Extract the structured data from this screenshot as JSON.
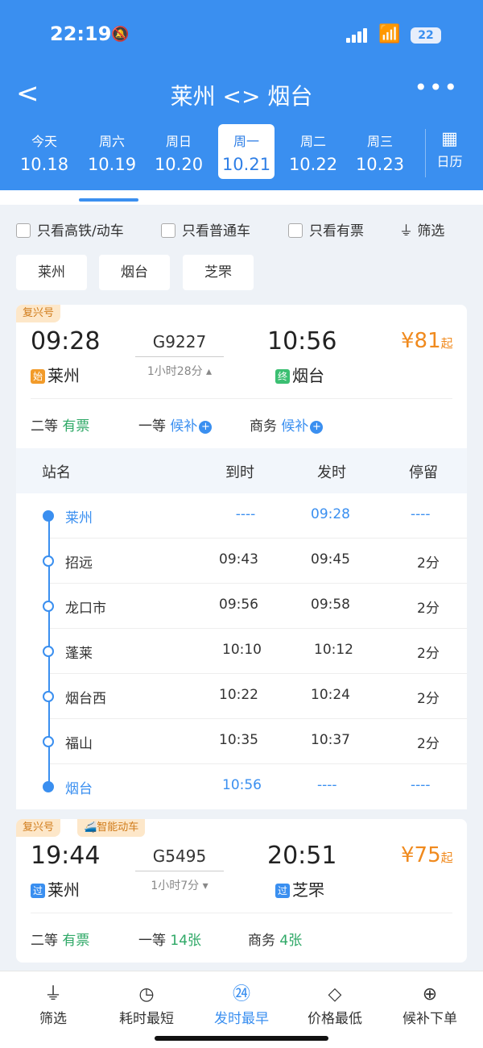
{
  "status": {
    "time": "22:19",
    "battery": "22"
  },
  "nav": {
    "back": "<",
    "title": "莱州 <> 烟台",
    "more": "•••"
  },
  "dates": [
    {
      "wd": "今天",
      "dd": "10.18"
    },
    {
      "wd": "周六",
      "dd": "10.19"
    },
    {
      "wd": "周日",
      "dd": "10.20"
    },
    {
      "wd": "周一",
      "dd": "10.21",
      "active": true
    },
    {
      "wd": "周二",
      "dd": "10.22"
    },
    {
      "wd": "周三",
      "dd": "10.23"
    }
  ],
  "calendar_label": "日历",
  "filters": {
    "highspeed": "只看高铁/动车",
    "normal": "只看普通车",
    "available": "只看有票",
    "filter_btn": "筛选"
  },
  "stations": [
    "莱州",
    "烟台",
    "芝罘"
  ],
  "train1": {
    "tag": "复兴号",
    "dep_time": "09:28",
    "dep_badge": "始",
    "dep_station": "莱州",
    "train_no": "G9227",
    "duration": "1小时28分 ▴",
    "arr_time": "10:56",
    "arr_badge": "终",
    "arr_station": "烟台",
    "price": "¥81",
    "price_suffix": "起",
    "seats": [
      {
        "cls": "二等",
        "status": "有票"
      },
      {
        "cls": "一等",
        "status": "候补"
      },
      {
        "cls": "商务",
        "status": "候补"
      }
    ],
    "stop_header": {
      "name": "站名",
      "arrive": "到时",
      "depart": "发时",
      "stay": "停留"
    },
    "stops": [
      {
        "name": "莱州",
        "arrive": "----",
        "depart": "09:28",
        "stay": "----"
      },
      {
        "name": "招远",
        "arrive": "09:43",
        "depart": "09:45",
        "stay": "2分"
      },
      {
        "name": "龙口市",
        "arrive": "09:56",
        "depart": "09:58",
        "stay": "2分"
      },
      {
        "name": "蓬莱",
        "arrive": "10:10",
        "depart": "10:12",
        "stay": "2分"
      },
      {
        "name": "烟台西",
        "arrive": "10:22",
        "depart": "10:24",
        "stay": "2分"
      },
      {
        "name": "福山",
        "arrive": "10:35",
        "depart": "10:37",
        "stay": "2分"
      },
      {
        "name": "烟台",
        "arrive": "10:56",
        "depart": "----",
        "stay": "----"
      }
    ]
  },
  "train2": {
    "tag": "复兴号",
    "tag2": "智能动车",
    "dep_time": "19:44",
    "dep_badge": "过",
    "dep_station": "莱州",
    "train_no": "G5495",
    "duration": "1小时7分 ▾",
    "arr_time": "20:51",
    "arr_badge": "过",
    "arr_station": "芝罘",
    "price": "¥75",
    "price_suffix": "起",
    "seats": [
      {
        "cls": "二等",
        "status": "有票"
      },
      {
        "cls": "一等",
        "status": "14张"
      },
      {
        "cls": "商务",
        "status": "4张"
      }
    ]
  },
  "bottom_tabs": [
    {
      "icon": "⏚",
      "label": "筛选"
    },
    {
      "icon": "◷",
      "label": "耗时最短"
    },
    {
      "icon": "㉔",
      "label": "发时最早",
      "active": true
    },
    {
      "icon": "◇",
      "label": "价格最低"
    },
    {
      "icon": "⊕",
      "label": "候补下单"
    }
  ],
  "colors": {
    "primary": "#3a8ff0",
    "price": "#f08a1e",
    "ok": "#2ea866"
  }
}
